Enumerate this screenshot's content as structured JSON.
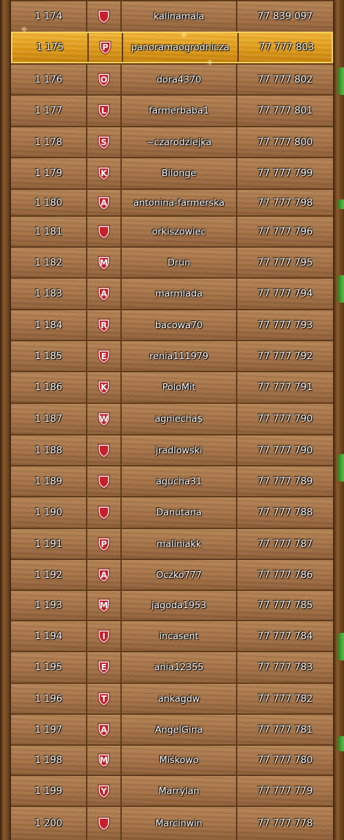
{
  "highlight_rank": "1 175",
  "rows": [
    {
      "rank": "1 174",
      "letter": "",
      "user": "kalinamala",
      "points": "77 839 097"
    },
    {
      "rank": "1 175",
      "letter": "P",
      "user": "panoramaogrodnicza",
      "points": "77 777 803"
    },
    {
      "rank": "1 176",
      "letter": "O",
      "user": "dora4370",
      "points": "77 777 802"
    },
    {
      "rank": "1 177",
      "letter": "L",
      "user": "farmerbaba1",
      "points": "77 777 801"
    },
    {
      "rank": "1 178",
      "letter": "S",
      "user": "~czarodziejka",
      "points": "77 777 800"
    },
    {
      "rank": "1 179",
      "letter": "K",
      "user": "Bilonge",
      "points": "77 777 799"
    },
    {
      "rank": "1 180",
      "letter": "A",
      "user": "antonina-farmerska",
      "points": "77 777 798"
    },
    {
      "rank": "1 181",
      "letter": "",
      "user": "orkiszowiec",
      "points": "77 777 796"
    },
    {
      "rank": "1 182",
      "letter": "M",
      "user": "Drun",
      "points": "77 777 795"
    },
    {
      "rank": "1 183",
      "letter": "A",
      "user": "marmlada",
      "points": "77 777 794"
    },
    {
      "rank": "1 184",
      "letter": "R",
      "user": "bacowa70",
      "points": "77 777 793"
    },
    {
      "rank": "1 185",
      "letter": "E",
      "user": "renia111979",
      "points": "77 777 792"
    },
    {
      "rank": "1 186",
      "letter": "K",
      "user": "PoloMit",
      "points": "77 777 791"
    },
    {
      "rank": "1 187",
      "letter": "W",
      "user": "agniecha$",
      "points": "77 777 790"
    },
    {
      "rank": "1 188",
      "letter": "",
      "user": "jradlowski",
      "points": "77 777 790"
    },
    {
      "rank": "1 189",
      "letter": "",
      "user": "agucha31",
      "points": "77 777 789"
    },
    {
      "rank": "1 190",
      "letter": "",
      "user": "Danutana",
      "points": "77 777 788"
    },
    {
      "rank": "1 191",
      "letter": "P",
      "user": "maliniakk",
      "points": "77 777 787"
    },
    {
      "rank": "1 192",
      "letter": "A",
      "user": "Oczko777",
      "points": "77 777 786"
    },
    {
      "rank": "1 193",
      "letter": "M",
      "user": "jagoda1953",
      "points": "77 777 785"
    },
    {
      "rank": "1 194",
      "letter": "I",
      "user": "incasent",
      "points": "77 777 784"
    },
    {
      "rank": "1 195",
      "letter": "E",
      "user": "ania12355",
      "points": "77 777 783"
    },
    {
      "rank": "1 196",
      "letter": "T",
      "user": "ankagdw",
      "points": "77 777 782"
    },
    {
      "rank": "1 197",
      "letter": "A",
      "user": "AngelGina",
      "points": "77 777 781"
    },
    {
      "rank": "1 198",
      "letter": "M",
      "user": "Miśkowo",
      "points": "77 777 780"
    },
    {
      "rank": "1 199",
      "letter": "Y",
      "user": "Marrylan",
      "points": "77 777 779"
    },
    {
      "rank": "1 200",
      "letter": "",
      "user": "Marcinwin",
      "points": "77 777 778"
    }
  ],
  "colors": {
    "wood": "#a27045",
    "highlight": "#e0a01a",
    "divider": "#5e3b1a",
    "tab": "#4aa834",
    "shield": "#c8202a"
  },
  "icons": {
    "badge": "shield-badge-icon",
    "scroll_tab": "green-tab-icon"
  }
}
